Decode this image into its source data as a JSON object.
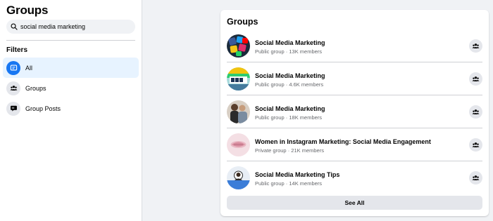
{
  "sidebar": {
    "title": "Groups",
    "search": {
      "value": "social media marketing"
    },
    "filters_label": "Filters",
    "filters": [
      {
        "label": "All",
        "active": true
      },
      {
        "label": "Groups",
        "active": false
      },
      {
        "label": "Group Posts",
        "active": false
      }
    ]
  },
  "results": {
    "title": "Groups",
    "groups": [
      {
        "name": "Social Media Marketing",
        "meta": "Public group · 13K members"
      },
      {
        "name": "Social Media Marketing",
        "meta": "Public group · 4.6K members"
      },
      {
        "name": "Social Media Marketing",
        "meta": "Public group · 18K members"
      },
      {
        "name": "Women in Instagram Marketing: Social Media Engagement",
        "meta": "Private group · 21K members"
      },
      {
        "name": "Social Media Marketing Tips",
        "meta": "Public group · 14K members"
      }
    ],
    "see_all": "See All"
  },
  "colors": {
    "accent": "#1877f2",
    "active_bg": "#e7f3ff",
    "page_bg": "#f0f2f5",
    "secondary_text": "#65676b"
  }
}
